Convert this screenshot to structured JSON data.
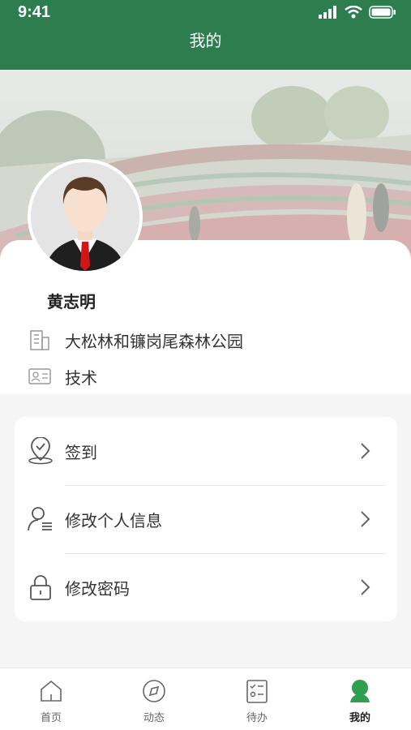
{
  "status_bar": {
    "time": "9:41"
  },
  "header": {
    "title": "我的"
  },
  "profile": {
    "name": "黄志明",
    "organization": "大松林和镰岗尾森林公园",
    "role": "技术"
  },
  "menu": {
    "items": [
      {
        "label": "签到",
        "icon": "location-check-icon"
      },
      {
        "label": "修改个人信息",
        "icon": "user-edit-icon"
      },
      {
        "label": "修改密码",
        "icon": "lock-icon"
      }
    ]
  },
  "tabbar": {
    "tabs": [
      {
        "label": "首页",
        "icon": "home-icon"
      },
      {
        "label": "动态",
        "icon": "compass-icon"
      },
      {
        "label": "待办",
        "icon": "checklist-icon"
      },
      {
        "label": "我的",
        "icon": "profile-icon"
      }
    ],
    "active": "我的"
  },
  "colors": {
    "brand": "#2e7d4f",
    "background": "#f5f5f5"
  }
}
